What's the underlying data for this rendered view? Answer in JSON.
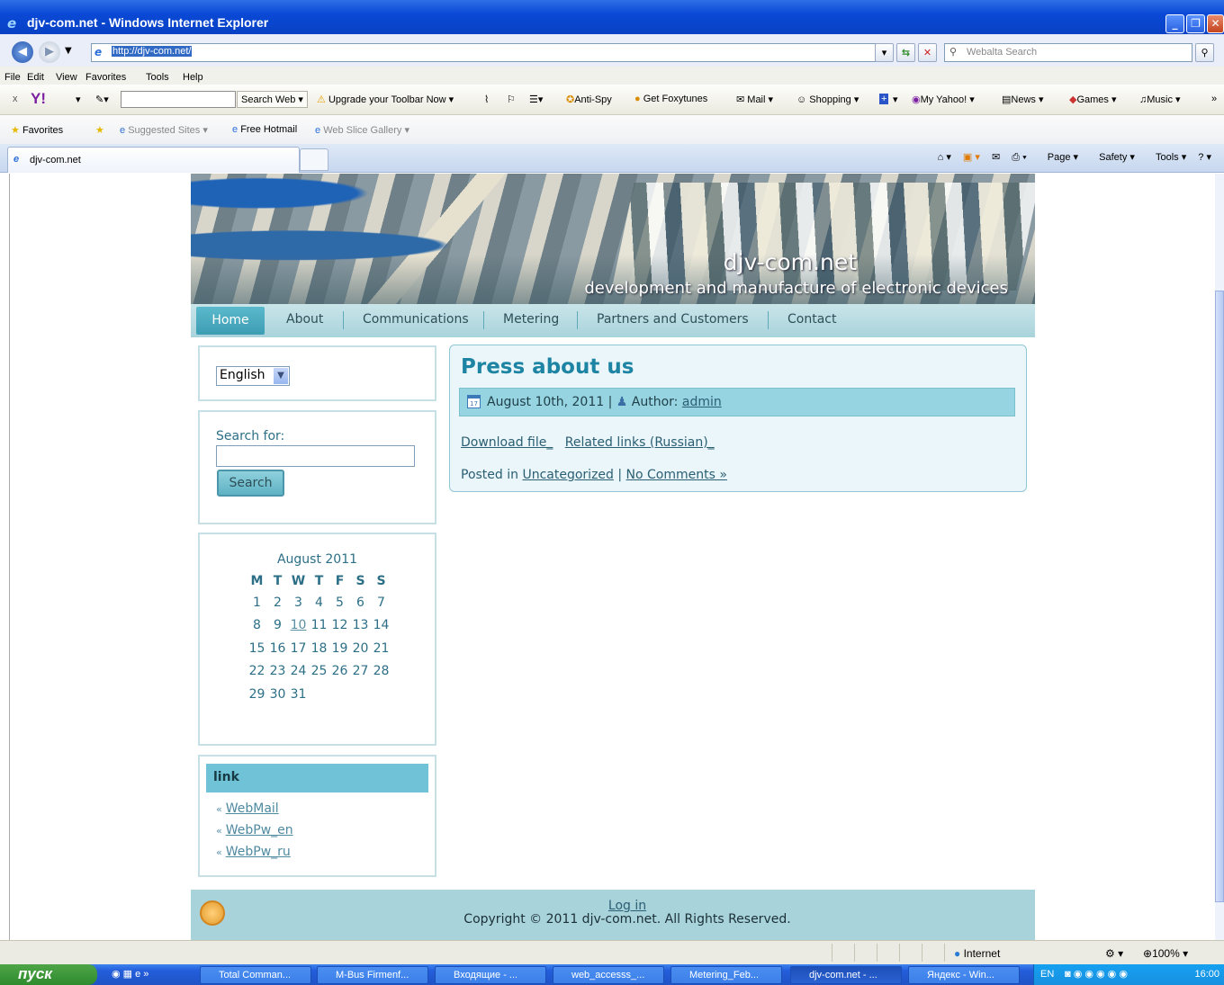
{
  "window": {
    "title": "djv-com.net - Windows Internet Explorer"
  },
  "address": {
    "url": "http://djv-com.net/",
    "search_placeholder": "Webalta Search"
  },
  "menu": [
    "File",
    "Edit",
    "View",
    "Favorites",
    "Tools",
    "Help"
  ],
  "yahoo_toolbar": {
    "search_web": "Search Web",
    "items": [
      "Upgrade your Toolbar Now",
      "Anti-Spy",
      "Get Foxytunes",
      "Mail",
      "Shopping",
      "My Yahoo!",
      "News",
      "Games",
      "Music"
    ]
  },
  "favorites_bar": {
    "favorites": "Favorites",
    "items": [
      "Suggested Sites",
      "Free Hotmail",
      "Web Slice Gallery"
    ]
  },
  "tab": {
    "title": "djv-com.net"
  },
  "command_bar": [
    "Page",
    "Safety",
    "Tools"
  ],
  "site": {
    "title": "djv-com.net",
    "tagline": "development and manufacture of electronic devices",
    "nav": [
      "Home",
      "About",
      "Communications",
      "Metering",
      "Partners and Customers",
      "Contact"
    ],
    "language": "English",
    "search": {
      "label": "Search for:",
      "button": "Search"
    },
    "calendar": {
      "caption": "August 2011",
      "days": [
        "M",
        "T",
        "W",
        "T",
        "F",
        "S",
        "S"
      ],
      "weeks": [
        [
          "1",
          "2",
          "3",
          "4",
          "5",
          "6",
          "7"
        ],
        [
          "8",
          "9",
          "10",
          "11",
          "12",
          "13",
          "14"
        ],
        [
          "15",
          "16",
          "17",
          "18",
          "19",
          "20",
          "21"
        ],
        [
          "22",
          "23",
          "24",
          "25",
          "26",
          "27",
          "28"
        ],
        [
          "29",
          "30",
          "31",
          "",
          "",
          "",
          ""
        ]
      ],
      "linked_day": "10"
    },
    "links_widget": {
      "title": "link",
      "items": [
        "WebMail",
        "WebPw_en",
        "WebPw_ru"
      ]
    },
    "post": {
      "title": "Press about us",
      "date": "August 10th, 2011",
      "author_label": "Author:",
      "author": "admin",
      "download": "Download file_",
      "related": "Related links (Russian)_",
      "posted_in": "Posted in",
      "category": "Uncategorized",
      "comments": "No Comments »"
    },
    "footer": {
      "login": "Log in",
      "copyright": "Copyright © 2011 djv-com.net. All Rights Reserved."
    }
  },
  "status": {
    "zone": "Internet",
    "zoom": "100%"
  },
  "taskbar": {
    "start": "пуск",
    "tasks": [
      "Total Comman...",
      "M-Bus Firmenf...",
      "Входящие - ...",
      "web_accesss_...",
      "Metering_Feb...",
      "djv-com.net - ...",
      "Яндекс - Win..."
    ],
    "lang": "EN",
    "clock": "16:00"
  }
}
